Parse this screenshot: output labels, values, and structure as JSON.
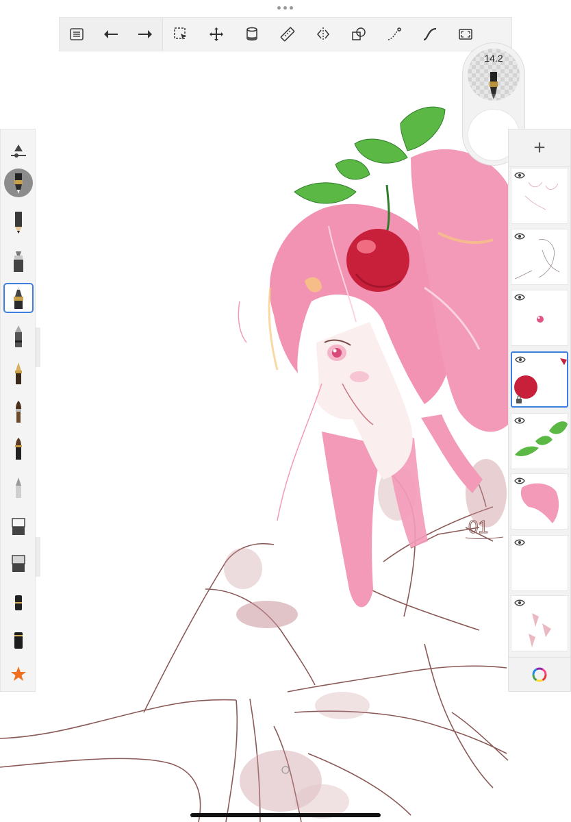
{
  "brush": {
    "size": "14.2"
  },
  "toolbar": {
    "tools": [
      "menu",
      "undo",
      "redo",
      "select",
      "transform",
      "fill",
      "ruler",
      "symmetry",
      "shape",
      "stroke",
      "curve",
      "fullscreen"
    ]
  },
  "left_toolbar": {
    "tools": [
      "brush-settings",
      "current-brush",
      "pencil",
      "marker",
      "inking-pen",
      "ballpoint-pen",
      "fountain-pen",
      "paint-brush",
      "ink-brush",
      "airbrush",
      "eraser",
      "soft-eraser",
      "smudge-small",
      "smudge-large",
      "favorites"
    ],
    "selected": "inking-pen"
  },
  "layers": {
    "count": 8,
    "selected_index": 3,
    "items": [
      {
        "thumb": "sketch-lines",
        "visible": true
      },
      {
        "thumb": "line-art",
        "visible": true
      },
      {
        "thumb": "eye-detail",
        "visible": true
      },
      {
        "thumb": "cherry",
        "visible": true,
        "locked": true
      },
      {
        "thumb": "leaves",
        "visible": true
      },
      {
        "thumb": "pink-hair",
        "visible": true
      },
      {
        "thumb": "empty",
        "visible": true
      },
      {
        "thumb": "shading",
        "visible": true
      }
    ]
  },
  "colors": {
    "accent": "#3d7fe0",
    "hair": "#f39ab8",
    "cherry": "#c8203a",
    "leaf": "#5cb845",
    "line": "#7a4a48"
  }
}
